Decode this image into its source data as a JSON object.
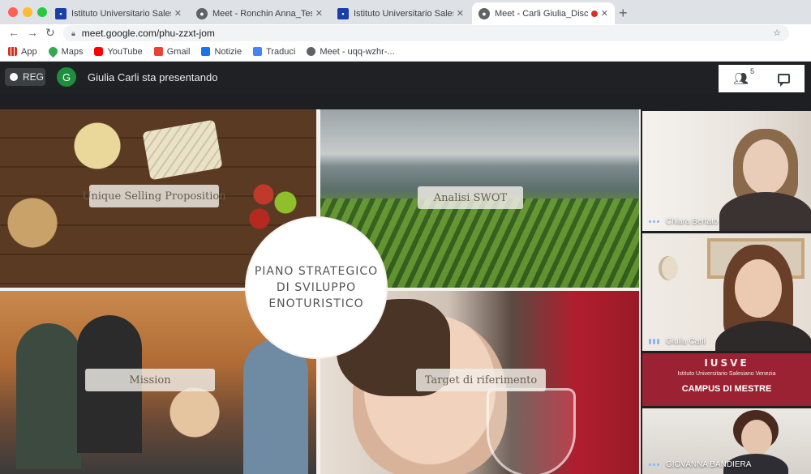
{
  "browser": {
    "tabs": [
      {
        "title": "Istituto Universitario Salesiano",
        "icon": "university-icon",
        "active": false
      },
      {
        "title": "Meet - Ronchin Anna_Tesi di M",
        "icon": "meet-icon",
        "active": false
      },
      {
        "title": "Istituto Universitario Salesiano",
        "icon": "university-icon",
        "active": false
      },
      {
        "title": "Meet - Carli Giulia_Discuss",
        "icon": "meet-icon",
        "active": true
      }
    ],
    "url": "meet.google.com/phu-zzxt-jom",
    "bookmarks": [
      {
        "label": "App",
        "icon": "apps-icon"
      },
      {
        "label": "Maps",
        "icon": "maps-icon"
      },
      {
        "label": "YouTube",
        "icon": "youtube-icon"
      },
      {
        "label": "Gmail",
        "icon": "gmail-icon"
      },
      {
        "label": "Notizie",
        "icon": "news-icon"
      },
      {
        "label": "Traduci",
        "icon": "translate-icon"
      },
      {
        "label": "Meet - uqq-wzhr-...",
        "icon": "meet-icon"
      }
    ]
  },
  "meet": {
    "rec_label": "REG",
    "presenter_initial": "G",
    "presenter_text": "Giulia Carli sta presentando",
    "participant_count": "5",
    "slide": {
      "center_title_lines": [
        "PIANO STRATEGICO",
        "DI SVILUPPO",
        "ENOTURISTICO"
      ],
      "labels": {
        "usp": "Unique Selling Proposition",
        "swot": "Analisi SWOT",
        "mission": "Mission",
        "target": "Target di riferimento"
      }
    },
    "participants": [
      {
        "name": "Chiara Bertato"
      },
      {
        "name": "Giulia Carli"
      },
      {
        "name": "CAMPUS DI MESTRE",
        "logo_text": "IUSVE",
        "logo_sub": "Istituto Universitario Salesiano Venezia"
      },
      {
        "name": "GIOVANNA BANDIERA"
      }
    ]
  },
  "colors": {
    "rec_dot": "#f8f9fa",
    "presenter_avatar": "#1e8e3e",
    "campus_red": "#9b2232",
    "speaking_indicator": "#8ab4f8"
  }
}
